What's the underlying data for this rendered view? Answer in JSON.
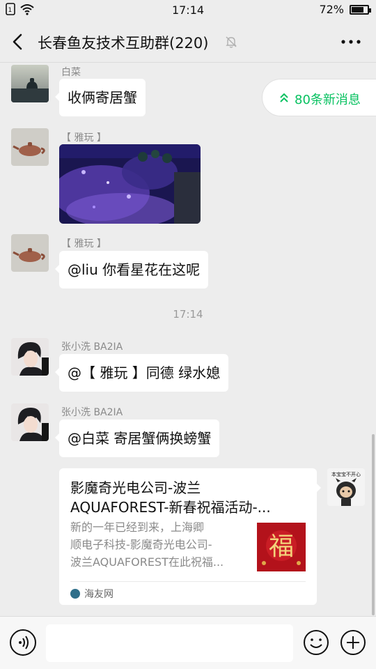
{
  "status_bar": {
    "time": "17:14",
    "battery_text": "72%",
    "battery_level": 0.72
  },
  "header": {
    "title": "长春鱼友技术互助群(220)",
    "back_icon": "chevron-left-icon",
    "mute_icon": "bell-off-icon",
    "more_icon": "more-dots-icon"
  },
  "new_messages": {
    "label": "80条新消息"
  },
  "messages": [
    {
      "sender": "白菜",
      "text": "收俩寄居蟹"
    },
    {
      "sender": "【 雅玩 】",
      "type": "image"
    },
    {
      "sender": "【 雅玩 】",
      "text": "@liu  你看星花在这呢"
    },
    {
      "sender": "张小洗 BA2IA",
      "text": "@【  雅玩  】同德   绿水媳"
    },
    {
      "sender": "张小洗 BA2IA",
      "text": "@白菜   寄居蟹俩换螃蟹"
    }
  ],
  "timestamp": "17:14",
  "link_card": {
    "title_line1": "影魔奇光电公司-波兰",
    "title_line2": "AQUAFOREST-新春祝福活动-...",
    "desc_line1": "新的一年已经到来，上海卿",
    "desc_line2": "顺电子科技-影魔奇光电公司-",
    "desc_line3": "波兰AQUAFOREST在此祝福...",
    "thumb_char": "福",
    "source": "海友网"
  },
  "right_avatar_caption": "本宝宝不开心",
  "input_bar": {
    "placeholder": ""
  },
  "colors": {
    "accent_green": "#07c160",
    "background": "#ededed",
    "bubble": "#ffffff"
  }
}
